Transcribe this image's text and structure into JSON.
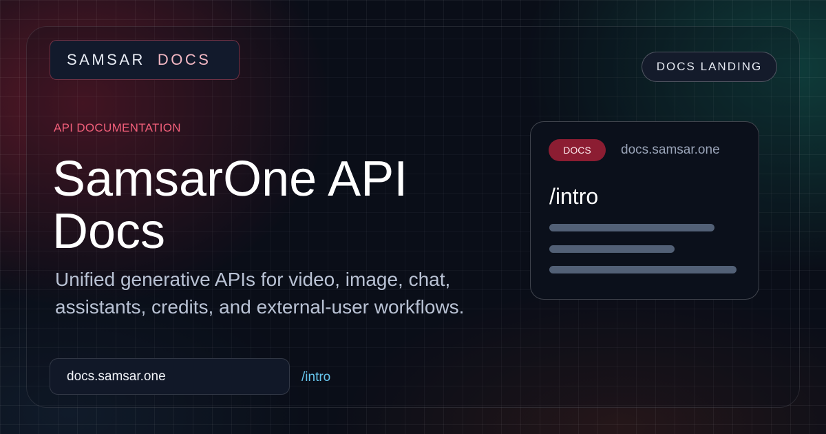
{
  "brand": {
    "name": "SAMSAR",
    "suffix": "DOCS"
  },
  "nav": {
    "landing_label": "DOCS LANDING"
  },
  "hero": {
    "eyebrow": "API DOCUMENTATION",
    "title": "SamsarOne API Docs",
    "subtitle": "Unified generative APIs for video, image, chat, assistants, credits, and external-user workflows."
  },
  "footer": {
    "url": "docs.samsar.one",
    "path": "/intro"
  },
  "preview_card": {
    "badge": "DOCS",
    "domain": "docs.samsar.one",
    "path": "/intro"
  },
  "colors": {
    "accent_pink": "#f25f7a",
    "badge_red": "#8c1d32",
    "link_blue": "#67c6ee",
    "background": "#0a0e18"
  }
}
